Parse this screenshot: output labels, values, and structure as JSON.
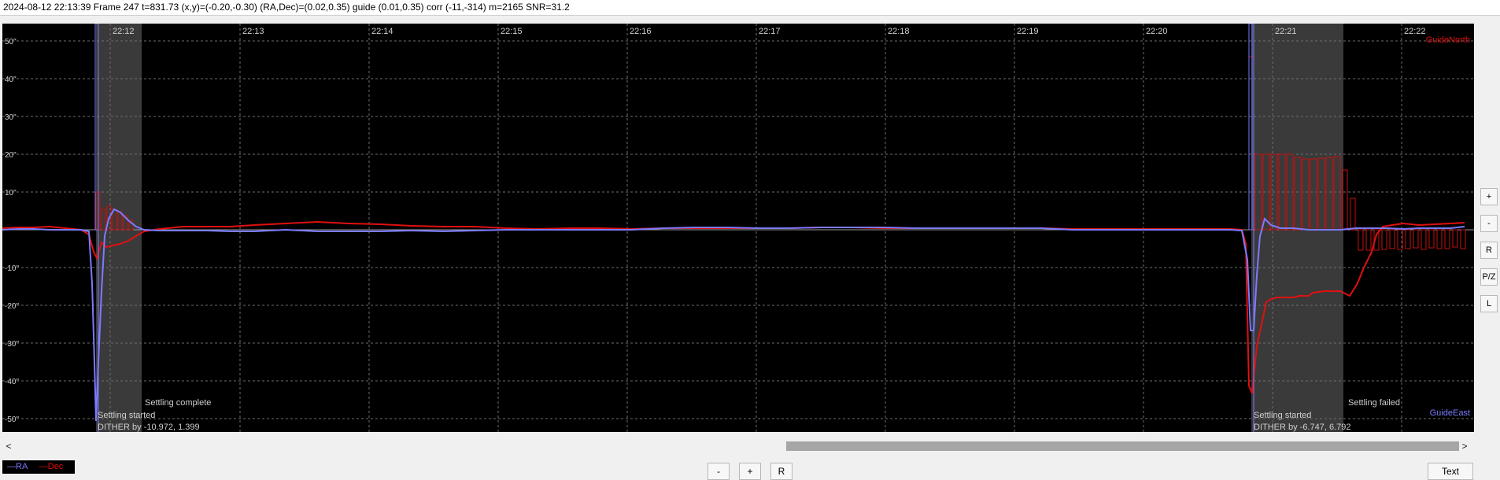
{
  "status_text": "2024-08-12 22:13:39 Frame 247 t=831.73 (x,y)=(-0.20,-0.30) (RA,Dec)=(0.02,0.35) guide (0.01,0.35) corr (-11,-314) m=2165 SNR=31.2",
  "colors": {
    "background": "#000000",
    "ra": "#7b7bff",
    "dec": "#e01010",
    "grid": "#6e6e6e",
    "settling_band": "#3a3a3a",
    "text": "#cfcfcf"
  },
  "graph": {
    "y_ticks": [
      "50\"",
      "40\"",
      "30\"",
      "20\"",
      "10\"",
      "",
      "-10\"",
      "-20\"",
      "-30\"",
      "-40\"",
      "-50\""
    ],
    "x_ticks": [
      "22:12",
      "22:13",
      "22:14",
      "22:15",
      "22:16",
      "22:17",
      "22:18",
      "22:19",
      "22:20",
      "22:21",
      "22:22"
    ],
    "guide_north_label": "GuideNorth",
    "guide_east_label": "GuideEast",
    "annotations": {
      "settling_started_1": "Settling started",
      "dither_1": "DITHER by -10.972, 1.399",
      "settling_complete": "Settling complete",
      "settling_started_2": "Settling started",
      "dither_2": "DITHER by -6.747, 6.792",
      "settling_failed": "Settling failed"
    }
  },
  "side_buttons": [
    "+",
    "-",
    "R",
    "P/Z",
    "L"
  ],
  "legend": {
    "ra_label": "—RA",
    "dec_label": "—Dec"
  },
  "bottom_buttons": {
    "minus": "-",
    "plus": "+",
    "reset": "R",
    "text": "Text"
  },
  "scroll": {
    "left_arrow": "<",
    "right_arrow": ">"
  }
}
